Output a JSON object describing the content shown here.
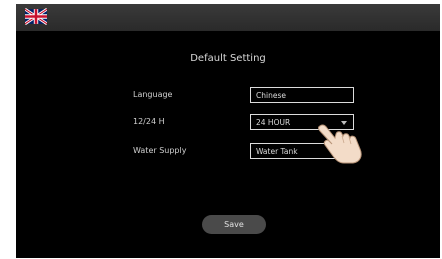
{
  "header": {
    "language_flag_icon": "uk-flag-icon"
  },
  "page": {
    "title": "Default Setting"
  },
  "settings": {
    "language": {
      "label": "Language",
      "value": "Chinese"
    },
    "time_format": {
      "label": "12/24 H",
      "value": "24 HOUR"
    },
    "water_supply": {
      "label": "Water Supply",
      "value": "Water Tank"
    }
  },
  "actions": {
    "save_label": "Save"
  },
  "colors": {
    "background": "#000000",
    "topbar": "#2e2e2e",
    "field_border": "#dcdcdc",
    "button": "#4a4a4a"
  }
}
